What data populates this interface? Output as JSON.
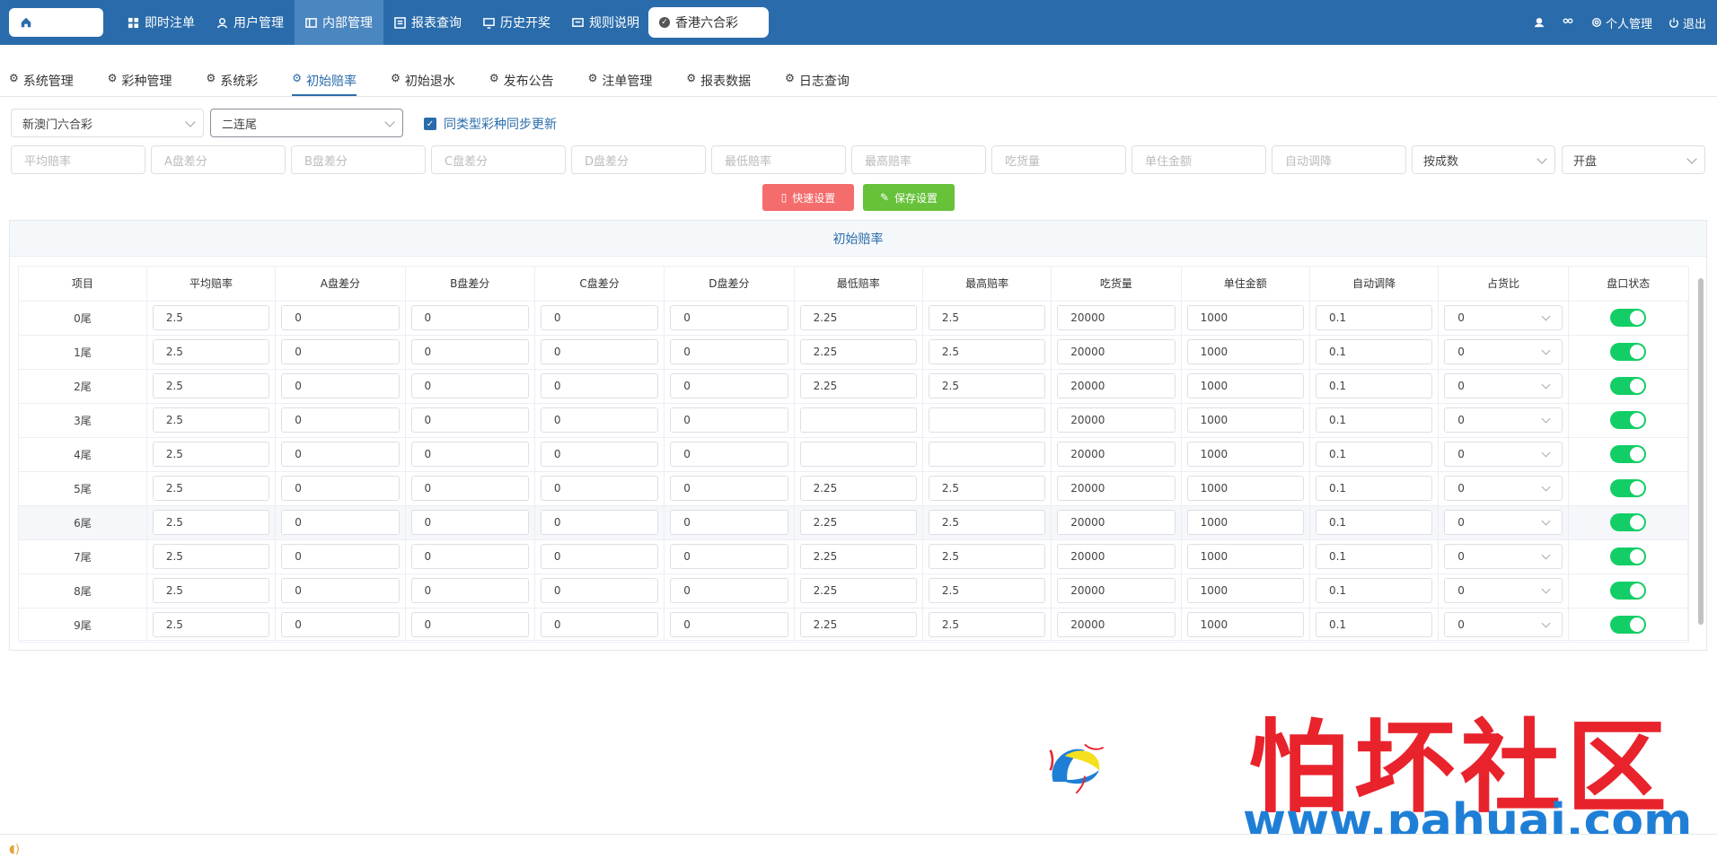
{
  "topbar": {
    "nav": [
      {
        "label": "即时注单",
        "icon": "grid-icon"
      },
      {
        "label": "用户管理",
        "icon": "user-icon"
      },
      {
        "label": "内部管理",
        "icon": "panel-icon",
        "active": true
      },
      {
        "label": "报表查询",
        "icon": "report-icon"
      },
      {
        "label": "历史开奖",
        "icon": "monitor-icon"
      },
      {
        "label": "规则说明",
        "icon": "message-icon"
      }
    ],
    "lottery_pill": "香港六合彩",
    "right": {
      "profile": "个人管理",
      "logout": "退出"
    }
  },
  "subtabs": [
    {
      "label": "系统管理"
    },
    {
      "label": "彩种管理"
    },
    {
      "label": "系统彩"
    },
    {
      "label": "初始赔率",
      "active": true
    },
    {
      "label": "初始退水"
    },
    {
      "label": "发布公告"
    },
    {
      "label": "注单管理"
    },
    {
      "label": "报表数据"
    },
    {
      "label": "日志查询"
    }
  ],
  "filters": {
    "lottery_select": "新澳门六合彩",
    "play_select": "二连尾",
    "sync_label": "同类型彩种同步更新"
  },
  "quick_inputs": {
    "placeholders": [
      "平均赔率",
      "A盘差分",
      "B盘差分",
      "C盘差分",
      "D盘差分",
      "最低赔率",
      "最高赔率",
      "吃货量",
      "单住金额",
      "自动调降"
    ],
    "ratio_select": "按成数",
    "status_select": "开盘"
  },
  "buttons": {
    "quick_set": "快速设置",
    "save_set": "保存设置"
  },
  "panel": {
    "title": "初始赔率",
    "columns": [
      "项目",
      "平均赔率",
      "A盘差分",
      "B盘差分",
      "C盘差分",
      "D盘差分",
      "最低赔率",
      "最高赔率",
      "吃货量",
      "单住金额",
      "自动调降",
      "占货比",
      "盘口状态"
    ],
    "rows": [
      {
        "item": "0尾",
        "avg": "2.5",
        "a": "0",
        "b": "0",
        "c": "0",
        "d": "0",
        "min": "2.25",
        "max": "2.5",
        "eat": "20000",
        "unit": "1000",
        "auto": "0.1",
        "ratio": "0"
      },
      {
        "item": "1尾",
        "avg": "2.5",
        "a": "0",
        "b": "0",
        "c": "0",
        "d": "0",
        "min": "2.25",
        "max": "2.5",
        "eat": "20000",
        "unit": "1000",
        "auto": "0.1",
        "ratio": "0"
      },
      {
        "item": "2尾",
        "avg": "2.5",
        "a": "0",
        "b": "0",
        "c": "0",
        "d": "0",
        "min": "2.25",
        "max": "2.5",
        "eat": "20000",
        "unit": "1000",
        "auto": "0.1",
        "ratio": "0"
      },
      {
        "item": "3尾",
        "avg": "2.5",
        "a": "0",
        "b": "0",
        "c": "0",
        "d": "0",
        "min": "",
        "max": "",
        "eat": "20000",
        "unit": "1000",
        "auto": "0.1",
        "ratio": "0"
      },
      {
        "item": "4尾",
        "avg": "2.5",
        "a": "0",
        "b": "0",
        "c": "0",
        "d": "0",
        "min": "",
        "max": "",
        "eat": "20000",
        "unit": "1000",
        "auto": "0.1",
        "ratio": "0"
      },
      {
        "item": "5尾",
        "avg": "2.5",
        "a": "0",
        "b": "0",
        "c": "0",
        "d": "0",
        "min": "2.25",
        "max": "2.5",
        "eat": "20000",
        "unit": "1000",
        "auto": "0.1",
        "ratio": "0"
      },
      {
        "item": "6尾",
        "avg": "2.5",
        "a": "0",
        "b": "0",
        "c": "0",
        "d": "0",
        "min": "2.25",
        "max": "2.5",
        "eat": "20000",
        "unit": "1000",
        "auto": "0.1",
        "ratio": "0",
        "highlight": true
      },
      {
        "item": "7尾",
        "avg": "2.5",
        "a": "0",
        "b": "0",
        "c": "0",
        "d": "0",
        "min": "2.25",
        "max": "2.5",
        "eat": "20000",
        "unit": "1000",
        "auto": "0.1",
        "ratio": "0"
      },
      {
        "item": "8尾",
        "avg": "2.5",
        "a": "0",
        "b": "0",
        "c": "0",
        "d": "0",
        "min": "2.25",
        "max": "2.5",
        "eat": "20000",
        "unit": "1000",
        "auto": "0.1",
        "ratio": "0"
      },
      {
        "item": "9尾",
        "avg": "2.5",
        "a": "0",
        "b": "0",
        "c": "0",
        "d": "0",
        "min": "2.25",
        "max": "2.5",
        "eat": "20000",
        "unit": "1000",
        "auto": "0.1",
        "ratio": "0"
      }
    ]
  },
  "watermark": {
    "title": "怕坏社区",
    "url": "www.pahuai.com"
  },
  "colors": {
    "primary": "#2a6cab",
    "danger": "#f56c6c",
    "success": "#67c23a",
    "switch_on": "#13ce66"
  }
}
